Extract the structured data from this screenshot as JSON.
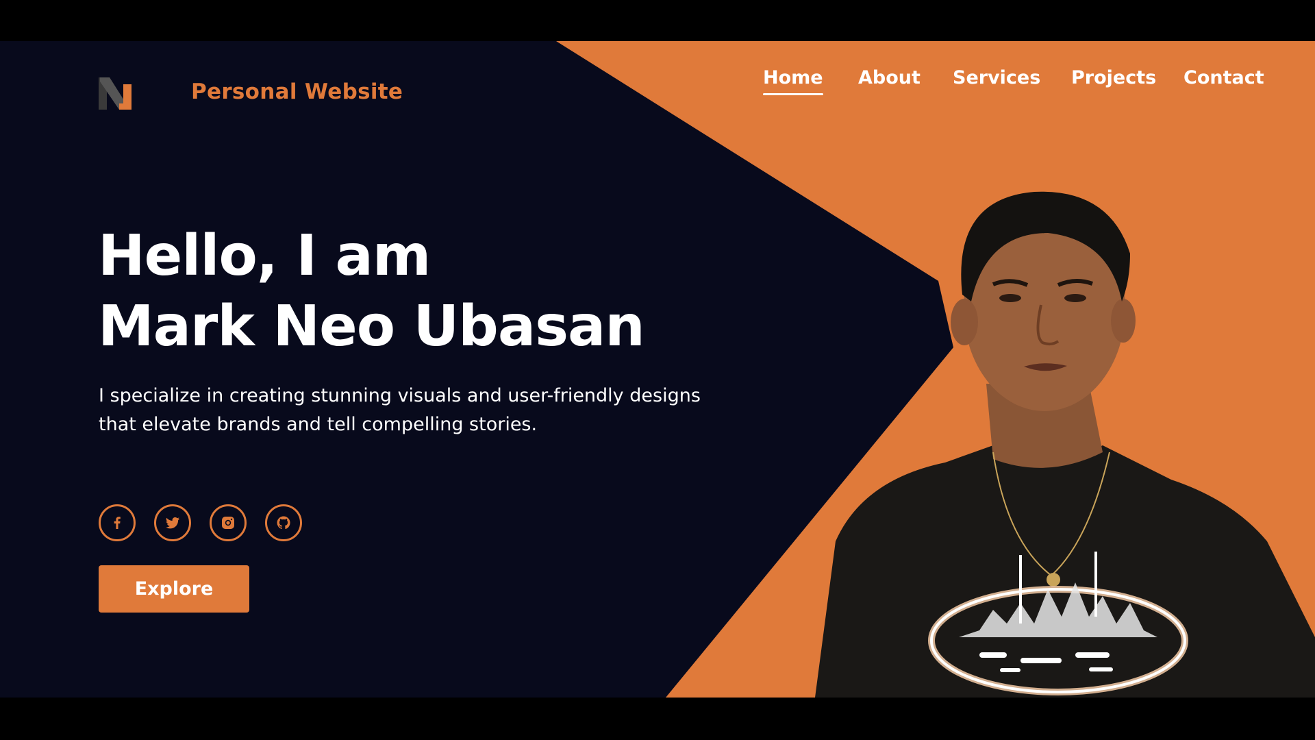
{
  "header": {
    "brand_name": "Personal Website",
    "logo_icon": "n-letter-logo-icon"
  },
  "nav": {
    "items": [
      {
        "label": "Home",
        "active": true
      },
      {
        "label": "About",
        "active": false
      },
      {
        "label": "Services",
        "active": false
      },
      {
        "label": "Projects",
        "active": false
      },
      {
        "label": "Contact",
        "active": false
      }
    ]
  },
  "hero": {
    "title_line1": "Hello, I am",
    "title_line2": "Mark Neo Ubasan",
    "description_line1": "I specialize in creating stunning visuals and user-friendly designs",
    "description_line2": "that elevate brands and tell compelling stories.",
    "socials": [
      {
        "icon": "facebook-icon"
      },
      {
        "icon": "twitter-icon"
      },
      {
        "icon": "instagram-icon"
      },
      {
        "icon": "github-icon"
      }
    ],
    "button_label": "Explore"
  },
  "colors": {
    "accent": "#e07a3a",
    "background": "#080a1c",
    "text": "#ffffff",
    "letterbox": "#000000"
  }
}
